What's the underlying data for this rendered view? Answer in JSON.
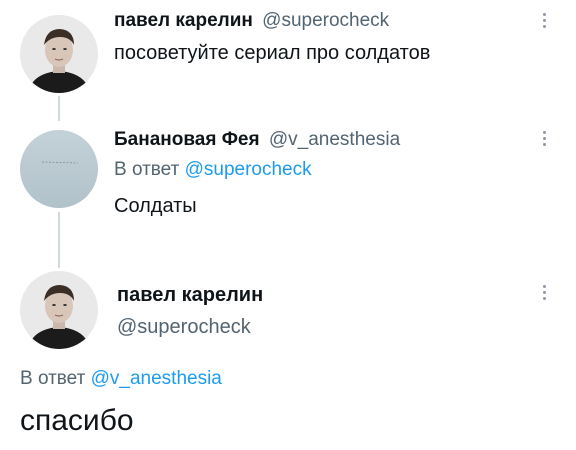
{
  "tweet1": {
    "name": "павел карелин",
    "handle": "@superocheck",
    "text": "посоветуйте сериал про солдатов",
    "more_icon": "more-vertical-icon"
  },
  "tweet2": {
    "name": "Банановая Фея",
    "handle": "@v_anesthesia",
    "reply_prefix": "В ответ",
    "reply_to": "@superocheck",
    "text": "Солдаты",
    "more_icon": "more-vertical-icon"
  },
  "tweet3": {
    "name": "павел карелин",
    "handle": "@superocheck",
    "reply_prefix": "В ответ",
    "reply_to": "@v_anesthesia",
    "text": "спасибо",
    "more_icon": "more-vertical-icon"
  },
  "colors": {
    "link": "#1d9bf0",
    "muted": "#536471",
    "thread_line": "#cfd9de"
  }
}
